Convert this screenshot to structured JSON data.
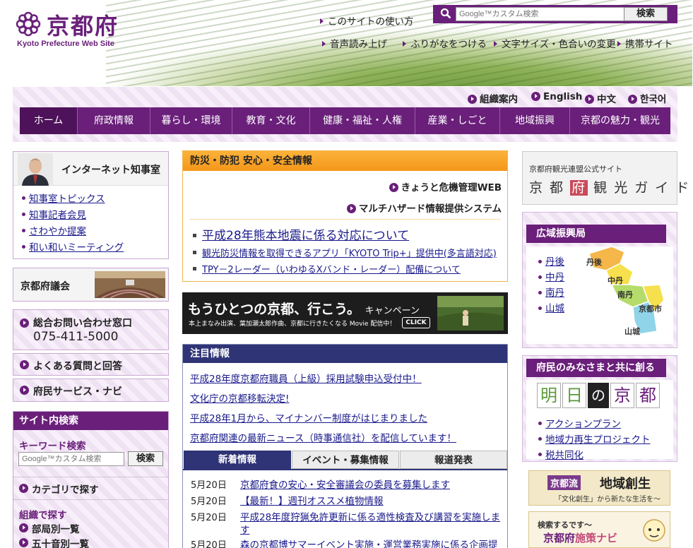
{
  "header": {
    "logo_text": "京都府",
    "logo_sub": "Kyoto Prefecture Web Site",
    "links_top": [
      "このサイトの使い方"
    ],
    "links_row": [
      "音声読み上げ",
      "ふりがなをつける",
      "文字サイズ・色合いの変更",
      "携帯サイト"
    ],
    "search": {
      "placeholder": "Google™カスタム検索",
      "button": "検索"
    }
  },
  "langs": [
    "組織案内",
    "English",
    "中文",
    "한국어"
  ],
  "nav": [
    "ホーム",
    "府政情報",
    "暮らし・環境",
    "教育・文化",
    "健康・福祉・人権",
    "産業・しごと",
    "地域振興",
    "京都の魅力・観光"
  ],
  "left": {
    "governor": {
      "title": "インターネット知事室",
      "links": [
        "知事室トピックス",
        "知事記者会見",
        "さわやか提案",
        "和い和いミーティング"
      ]
    },
    "assembly": "京都府議会",
    "contact": {
      "label": "総合お問い合わせ窓口",
      "phone": "075-411-5000"
    },
    "faq": "よくある質問と回答",
    "services": "府民サービス・ナビ",
    "search": {
      "title": "サイト内検索",
      "keyword_label": "キーワード検索",
      "placeholder": "Google™カスタム検索",
      "button": "検索",
      "category": "カテゴリで探す",
      "org_label": "組織で探す",
      "by_dept": "部局別一覧",
      "by_kana": "五十音別一覧"
    }
  },
  "center": {
    "disaster": {
      "title": "防災・防犯 安心・安全情報",
      "link1": "きょうと危機管理WEB",
      "link2": "マルチハザード情報提供システム",
      "items": [
        "平成28年熊本地震に係る対応について",
        "観光防災情報を取得できるアプリ「KYOTO Trip+」提供中(多言語対応)",
        "TPY－2レーダー（いわゆるXバンド・レーダー）配備について"
      ]
    },
    "campaign": {
      "title": "もうひとつの京都、行こう。",
      "title_suffix": "キャンペーン",
      "sub": "本上まなみ出演、葉加瀬太郎作曲、京都に行きたくなる Movie 配信中！",
      "click": "CLICK"
    },
    "attention": {
      "title": "注目情報",
      "items": [
        "平成28年度京都府職員（上級）採用試験申込受付中！",
        "文化庁の京都移転決定!",
        "平成28年1月から、マイナンバー制度がはじまりました",
        "京都府関連の最新ニュース（時事通信社）を配信しています！"
      ]
    },
    "tabs": [
      "新着情報",
      "イベント・募集情報",
      "報道発表"
    ],
    "news": [
      {
        "date": "5月20日",
        "text": "京都府食の安心・安全審議会の委員を募集します"
      },
      {
        "date": "5月20日",
        "text": "【最新！】週刊オススメ植物情報"
      },
      {
        "date": "5月20日",
        "text": "平成28年度狩猟免許更新に係る適性検査及び講習を実施しま",
        "cont": "す"
      },
      {
        "date": "5月20日",
        "text": "森の京都博サマーイベント実施・運営業務実施に係る企画提"
      }
    ]
  },
  "right": {
    "tourism": {
      "line1": "京都府観光連盟公式サイト",
      "line2a": "京 都",
      "line2b": "府",
      "line2c": "観 光 ガ イ ド"
    },
    "regional": {
      "title": "広域振興局",
      "items": [
        "丹後",
        "中丹",
        "南丹",
        "山城"
      ],
      "map_labels": [
        "丹後",
        "中丹",
        "南丹",
        "京都市",
        "山城"
      ]
    },
    "future": {
      "title": "府民のみなさまと共に創る",
      "chars": [
        "明",
        "日",
        "の",
        "京",
        "都"
      ],
      "links": [
        "アクションプラン",
        "地域力再生プロジェクト",
        "税共同化"
      ]
    },
    "sousei": {
      "tag": "京都流",
      "title": "地域創生",
      "sub": "「文化創生」から新たな生活を～"
    },
    "navi": {
      "lead": "検索するです～",
      "brand": "京都府",
      "title": "施策ナビ"
    }
  },
  "colors": {
    "brand": "#6a1f7a",
    "orange": "#f5a623",
    "navy": "#2e3475"
  }
}
